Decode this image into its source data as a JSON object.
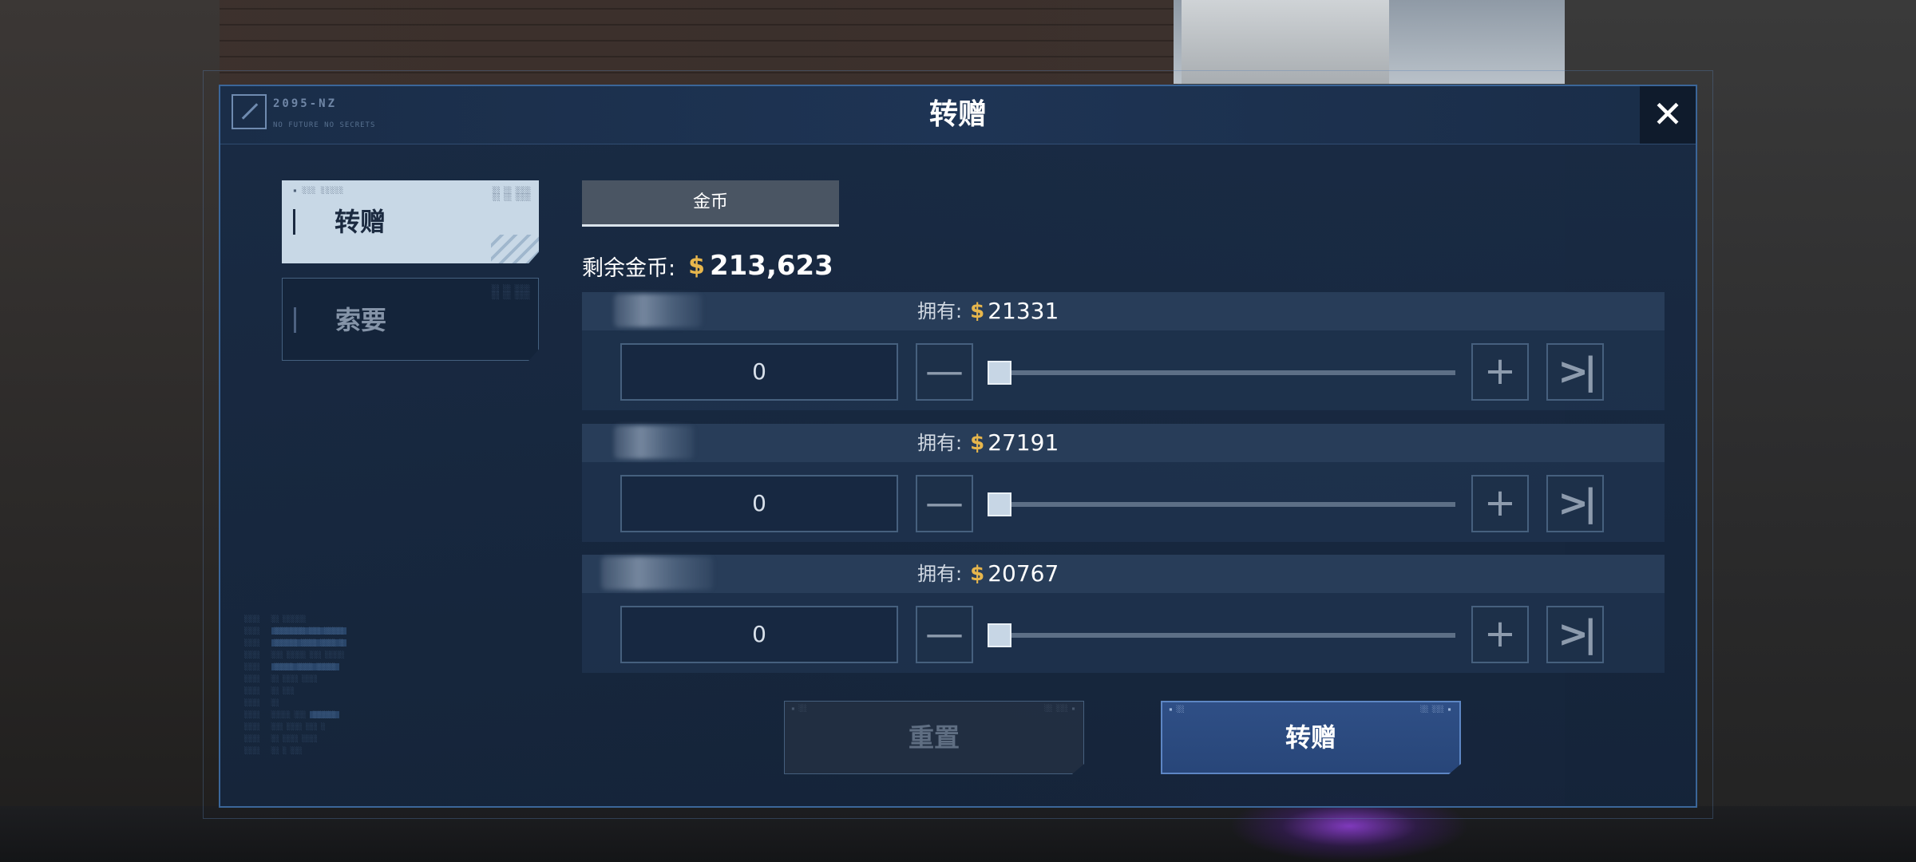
{
  "dialog": {
    "title": "转赠",
    "brand": "2095-NZ",
    "brand_sub": "NO FUTURE NO SECRETS",
    "close_symbol": "✕"
  },
  "side_tabs": [
    {
      "label": "转赠",
      "active": true
    },
    {
      "label": "索要",
      "active": false
    }
  ],
  "currency_tab": {
    "label": "金币"
  },
  "balance": {
    "label": "剩余金币:",
    "coin_icon": "$",
    "value": "213,623"
  },
  "players": [
    {
      "owned_label": "拥有:",
      "coin_icon": "$",
      "owned": "21331",
      "amount": "0",
      "slider_fraction": 0
    },
    {
      "owned_label": "拥有:",
      "coin_icon": "$",
      "owned": "27191",
      "amount": "0",
      "slider_fraction": 0
    },
    {
      "owned_label": "拥有:",
      "coin_icon": "$",
      "owned": "20767",
      "amount": "0",
      "slider_fraction": 0
    }
  ],
  "controls": {
    "minus_symbol": "—",
    "plus_symbol": "+",
    "max_symbol": ">|"
  },
  "buttons": {
    "reset_label": "重置",
    "transfer_label": "转赠"
  },
  "colors": {
    "accent": "#3b6699",
    "coin": "#e7b64c",
    "active_tab": "#c8d8e6"
  }
}
